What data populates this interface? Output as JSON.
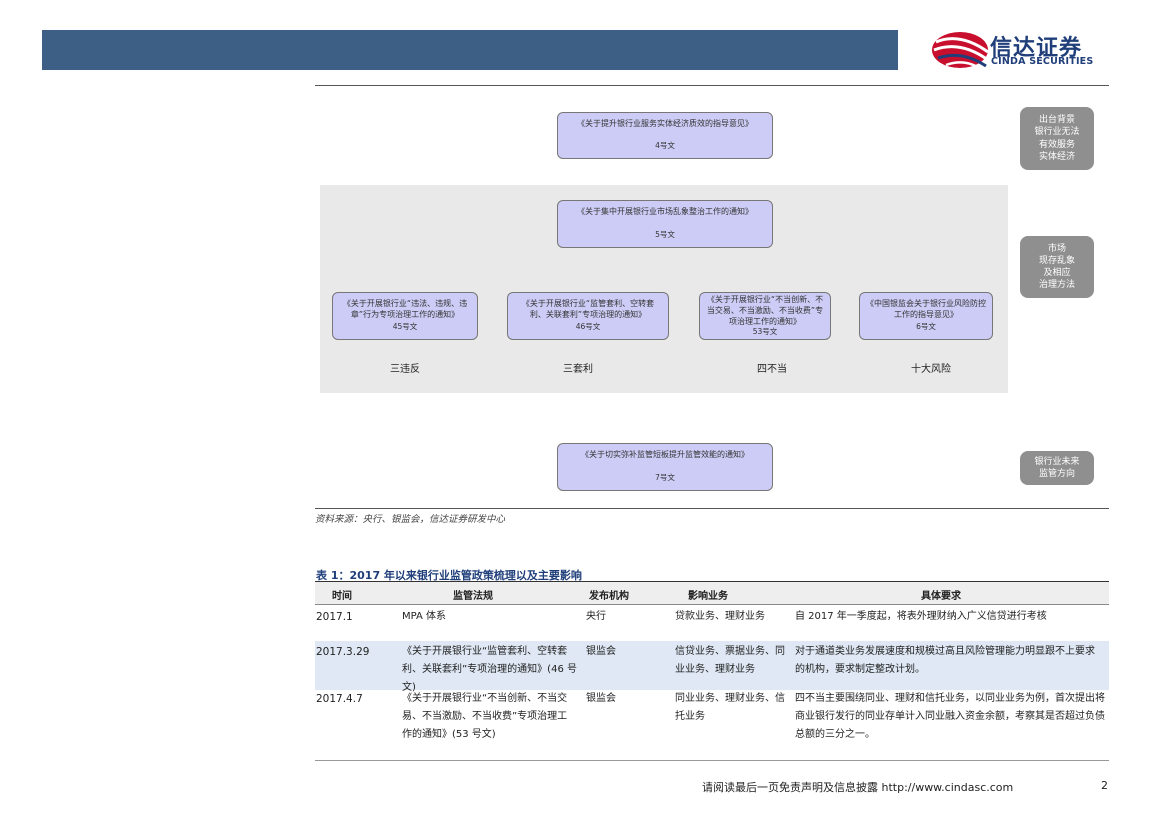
{
  "header": {
    "logo_zh": "信达证券",
    "logo_en": "CINDA SECURITIES",
    "colors": {
      "bar": "#3d5f86",
      "logo_red": "#c8102e",
      "logo_blue": "#1f3e7a"
    }
  },
  "diagram": {
    "top_node": {
      "title": "《关于提升银行业服务实体经济质效的指导意见》",
      "doc": "4号文"
    },
    "middle_node": {
      "title": "《关于集中开展银行业市场乱象整治工作的通知》",
      "doc": "5号文"
    },
    "sub_nodes": [
      {
        "title": "《关于开展银行业“违法、违规、违章”行为专项治理工作的通知》",
        "doc": "45号文",
        "category": "三违反"
      },
      {
        "title": "《关于开展银行业“监管套利、空转套利、关联套利”专项治理的通知》",
        "doc": "46号文",
        "category": "三套利"
      },
      {
        "title": "《关于开展银行业“不当创新、不当交易、不当激励、不当收费”专项治理工作的通知》",
        "doc": "53号文",
        "category": "四不当"
      },
      {
        "title": "《中国银监会关于银行业风险防控工作的指导意见》",
        "doc": "6号文",
        "category": "十大风险"
      }
    ],
    "bottom_node": {
      "title": "《关于切实弥补监管短板提升监管效能的通知》",
      "doc": "7号文"
    },
    "side_labels": {
      "top": "出台背景\n银行业无法\n有效服务\n实体经济",
      "middle": "市场\n现存乱象\n及相应\n治理方法",
      "bottom": "银行业未来\n监管方向"
    },
    "colors": {
      "node_fill": "#ccccf6",
      "band": "#e9e9e9",
      "side_fill": "#8f8f8f"
    }
  },
  "source_note": "资料来源：央行、银监会，信达证券研发中心",
  "table": {
    "title": "表 1：2017 年以来银行业监管政策梳理以及主要影响",
    "headers": [
      "时间",
      "监管法规",
      "发布机构",
      "影响业务",
      "具体要求"
    ],
    "rows": [
      {
        "date": "2017.1",
        "regulation": "MPA 体系",
        "issuer": "央行",
        "business": "贷款业务、理财业务",
        "requirement": "自 2017 年一季度起，将表外理财纳入广义信贷进行考核",
        "shaded": false
      },
      {
        "date": "2017.3.29",
        "regulation": "《关于开展银行业“监管套利、空转套利、关联套利”专项治理的通知》(46 号文)",
        "issuer": "银监会",
        "business": "信贷业务、票据业务、同业业务、理财业务",
        "requirement": "对于通道类业务发展速度和规模过高且风险管理能力明显跟不上要求的机构，要求制定整改计划。",
        "shaded": true
      },
      {
        "date": "2017.4.7",
        "regulation": "《关于开展银行业“不当创新、不当交易、不当激励、不当收费”专项治理工作的通知》(53 号文)",
        "issuer": "银监会",
        "business": "同业业务、理财业务、信托业务",
        "requirement": "四不当主要围绕同业、理财和信托业务，以同业业务为例，首次提出将商业银行发行的同业存单计入同业融入资金余额，考察其是否超过负债总额的三分之一。",
        "shaded": false
      }
    ],
    "shade_color": "#dfe8f4"
  },
  "footer": {
    "text": "请阅读最后一页免责声明及信息披露 http://www.cindasc.com",
    "page": "2"
  }
}
